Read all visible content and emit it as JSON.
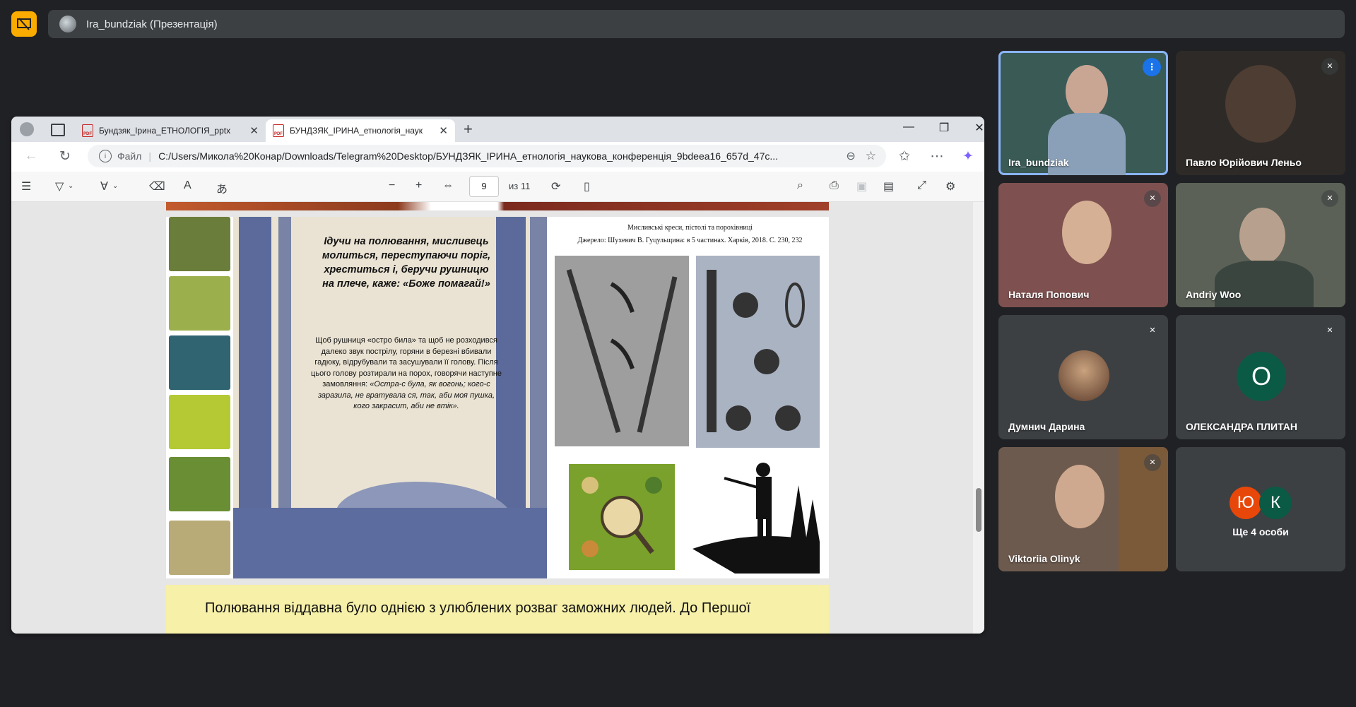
{
  "meet": {
    "presenter_title": "Ira_bundziak (Презентація)",
    "accent": "#f9ab00"
  },
  "browser": {
    "tabs": [
      {
        "label": "Бундзяк_Ірина_ЕТНОЛОГІЯ_pptx",
        "icon": "pdf-icon"
      },
      {
        "label": "БУНДЗЯК_ІРИНА_етнологія_наук",
        "icon": "pdf-icon"
      }
    ],
    "address": {
      "scheme_label": "Файл",
      "url": "C:/Users/Микола%20Конар/Downloads/Telegram%20Desktop/БУНДЗЯК_ІРИНА_етнологія_наукова_конференція_9bdeea16_657d_47c..."
    },
    "pdf_toolbar": {
      "page": "9",
      "of_total": "из 11"
    }
  },
  "slide": {
    "pdf_icon_text": "PDF",
    "quote": "Ідучи на полювання, мисливець молиться, переступаючи поріг, хреститься і, беручи рушницю на плече, каже: «Боже помагай!»",
    "paragraph_plain": "Щоб рушниця «остро била» та щоб не розходився далеко звук пострілу, горяни в березні вбивали гадюку, відрубували та засушували її голову. Після цього голову розтирали на порох, говорячи наступне замовляння: ",
    "paragraph_italic": "«Остра-с була, як вогонь; кого-с заразила, не вратувала ся, так, аби моя пушка, кого закрасит, аби не втік».",
    "caption_title": "Мисливські креси, пістолі та порохівниці",
    "caption_source": "Джерело: Шухевич В. Гуцульщина: в 5 частинах. Харків, 2018. С. 230, 232",
    "next_text": "Полювання віддавна було однією з улюблених розваг заможних людей. До Першої"
  },
  "participants": [
    {
      "name": "Ira_bundziak",
      "speaking": true
    },
    {
      "name": "Павло Юрійович Леньо",
      "muted": true
    },
    {
      "name": "Наталя Попович",
      "muted": true
    },
    {
      "name": "Andriy Woo",
      "muted": true
    },
    {
      "name": "Думнич Дарина",
      "muted": true
    },
    {
      "name": "ОЛЕКСАНДРА ПЛИТАН",
      "muted": true,
      "initial": "О",
      "color": "#0b5a45"
    },
    {
      "name": "Viktoriia Olinyk",
      "muted": true
    },
    {
      "more_label": "Ще 4 особи",
      "initials": [
        "Ю",
        "К"
      ],
      "colors": [
        "#e8470a",
        "#0b5a45"
      ]
    }
  ]
}
